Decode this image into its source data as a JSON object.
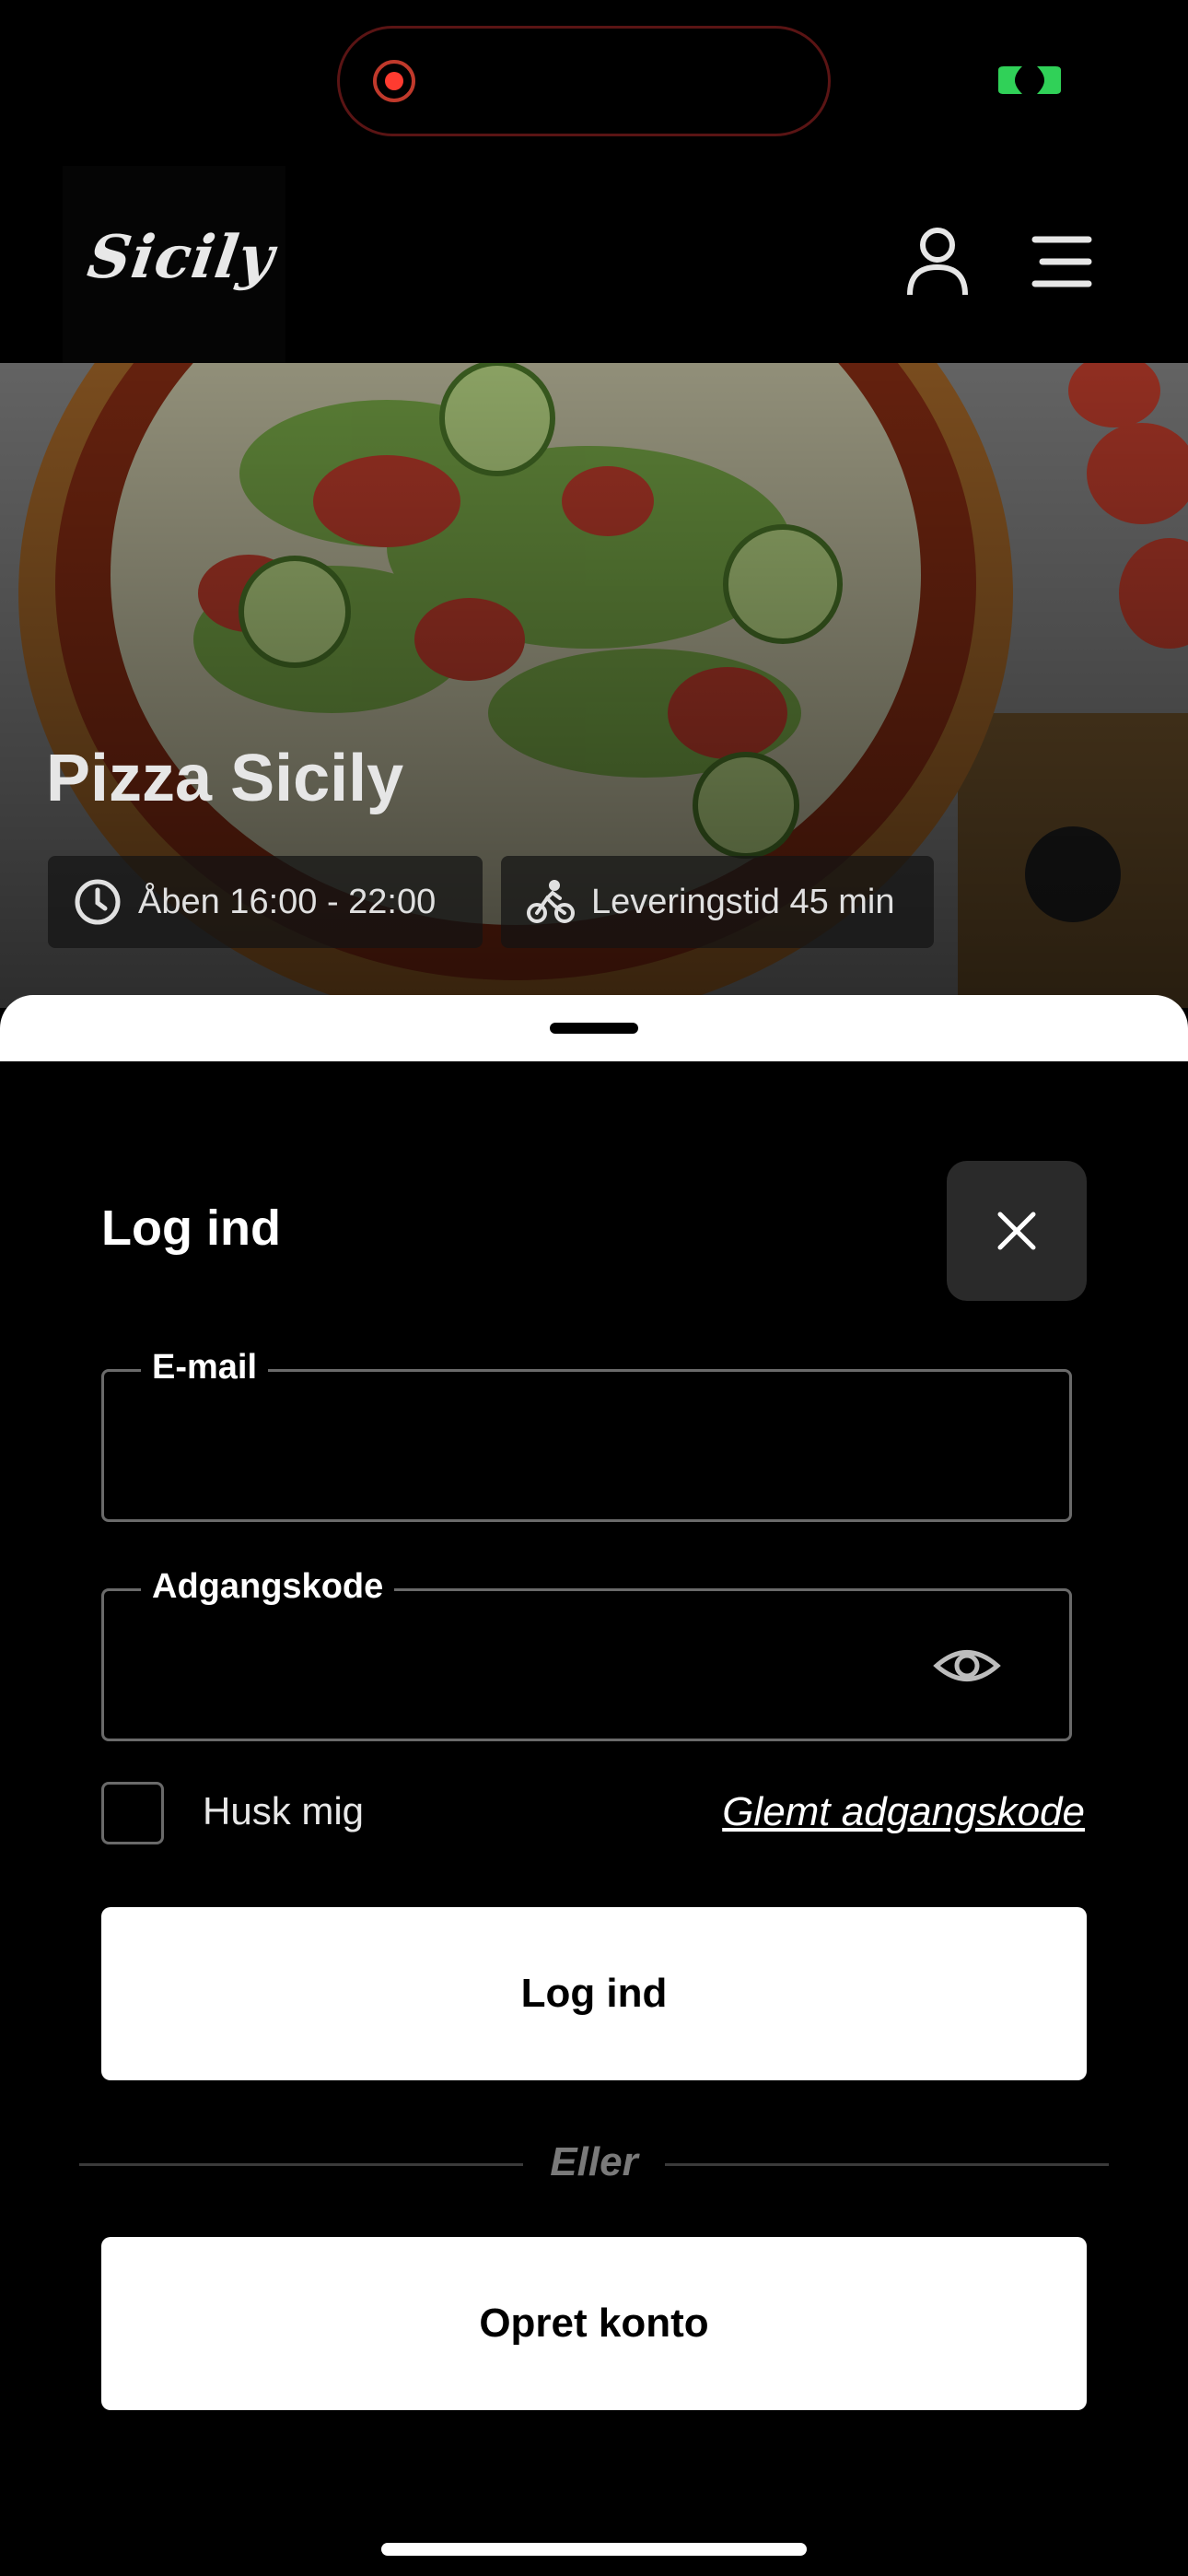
{
  "brand": {
    "logo_text": "Sicily"
  },
  "hero": {
    "title": "Pizza Sicily",
    "open_hours": "Åben 16:00 - 22:00",
    "delivery_time": "Leveringstid 45 min"
  },
  "login": {
    "title": "Log ind",
    "email_label": "E-mail",
    "email_value": "",
    "password_label": "Adgangskode",
    "password_value": "",
    "remember_label": "Husk mig",
    "forgot_label": "Glemt adgangskode",
    "login_button": "Log ind",
    "divider": "Eller",
    "create_button": "Opret konto"
  },
  "icons": {
    "status": [
      "recording-icon",
      "camera-active-indicator-icon"
    ],
    "header": [
      "user-icon",
      "menu-icon"
    ],
    "hero": [
      "clock-icon",
      "bicycle-icon"
    ],
    "sheet": [
      "close-icon",
      "eye-icon"
    ]
  },
  "colors": {
    "background": "#000000",
    "button": "#ffffff",
    "close_button": "#2a2a2a",
    "recording": "#ff3b30",
    "indicator": "#30d158"
  }
}
